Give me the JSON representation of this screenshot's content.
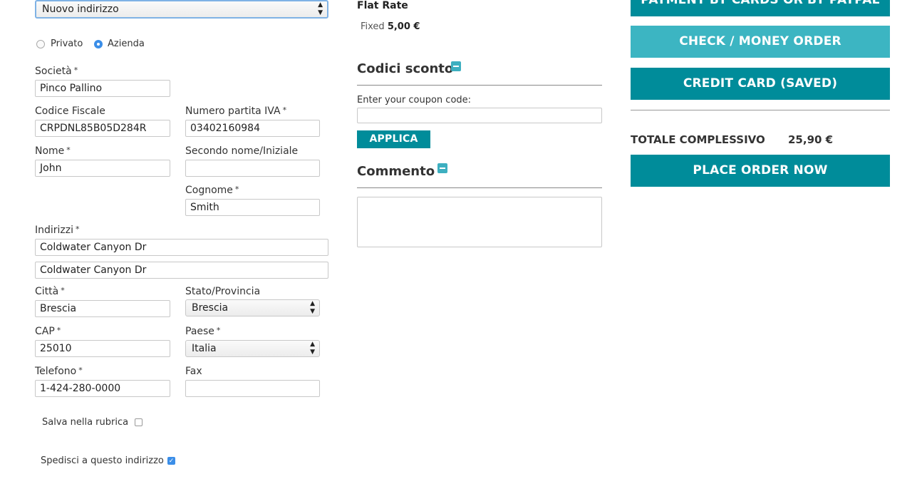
{
  "address_select": "Nuovo indirizzo",
  "customer_type": {
    "private": "Privato",
    "company": "Azienda",
    "selected": "Azienda"
  },
  "fields": {
    "company": {
      "label": "Società",
      "value": "Pinco Pallino"
    },
    "fiscal_code": {
      "label": "Codice Fiscale",
      "value": "CRPDNL85B05D284R"
    },
    "vat": {
      "label": "Numero partita IVA",
      "value": "03402160984"
    },
    "first_name": {
      "label": "Nome",
      "value": "John"
    },
    "middle_name": {
      "label": "Secondo nome/Iniziale",
      "value": ""
    },
    "last_name": {
      "label": "Cognome",
      "value": "Smith"
    },
    "street": {
      "label": "Indirizzi",
      "line1": "Coldwater Canyon Dr",
      "line2": "Coldwater Canyon Dr"
    },
    "city": {
      "label": "Città",
      "value": "Brescia"
    },
    "region": {
      "label": "Stato/Provincia",
      "value": "Brescia"
    },
    "postcode": {
      "label": "CAP",
      "value": "25010"
    },
    "country": {
      "label": "Paese",
      "value": "Italia"
    },
    "phone": {
      "label": "Telefono",
      "value": "1-424-280-0000"
    },
    "fax": {
      "label": "Fax",
      "value": ""
    }
  },
  "required_mark": "*",
  "save_in_address_book": {
    "label": "Salva nella rubrica",
    "checked": false
  },
  "ship_to_address": {
    "label": "Spedisci a questo indirizzo",
    "checked": true
  },
  "shipping": {
    "method": "Flat Rate",
    "type": "Fixed",
    "price": "5,00 €"
  },
  "coupon": {
    "title": "Codici sconto",
    "label": "Enter your coupon code:",
    "value": "",
    "button": "APPLICA"
  },
  "comment": {
    "title": "Commento",
    "value": ""
  },
  "payment": {
    "option_top": "PAYMENT BY CARDS OR BY PAYPAL",
    "option_check": "CHECK / MONEY ORDER",
    "option_credit": "CREDIT CARD (SAVED)"
  },
  "totals": {
    "label": "TOTALE COMPLESSIVO",
    "value": "25,90 €"
  },
  "place_order": "PLACE ORDER NOW",
  "colors": {
    "teal": "#008c9a",
    "light_teal": "#3cb5c2",
    "radio_blue": "#3b8ee8"
  }
}
